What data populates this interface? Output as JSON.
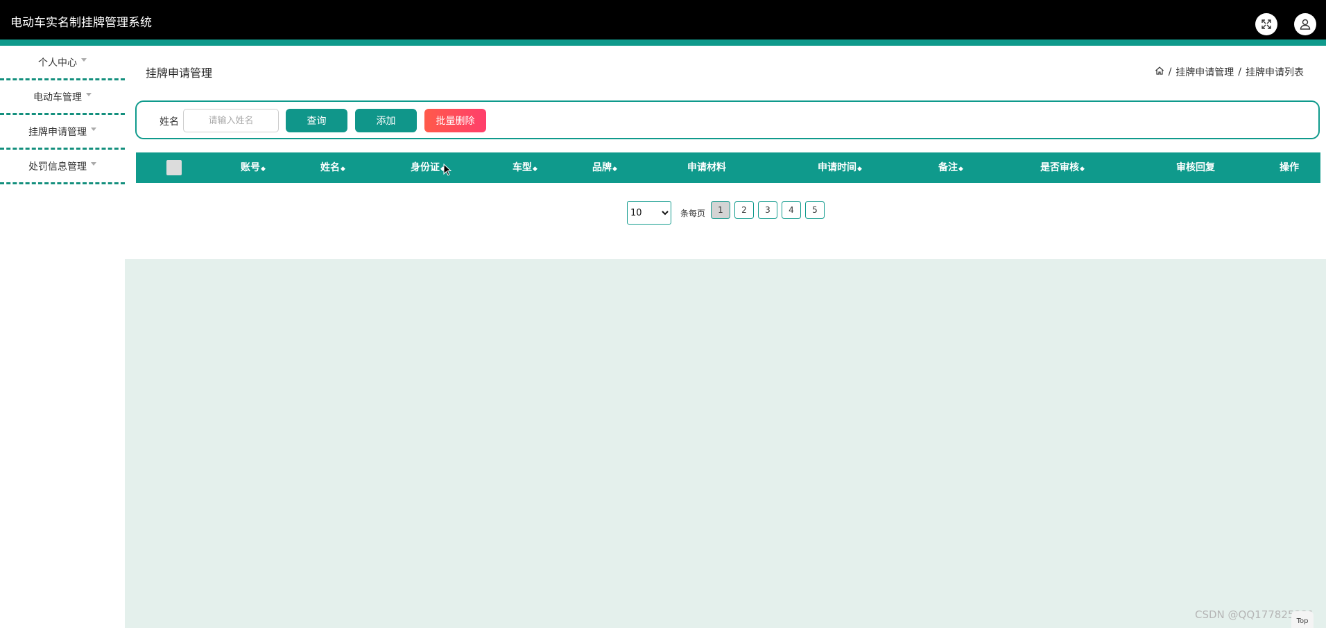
{
  "header": {
    "app_title": "电动车实名制挂牌管理系统",
    "icons": [
      "expand-icon",
      "user-icon"
    ]
  },
  "sidebar": {
    "items": [
      {
        "label": "个人中心"
      },
      {
        "label": "电动车管理"
      },
      {
        "label": "挂牌申请管理"
      },
      {
        "label": "处罚信息管理"
      }
    ]
  },
  "main": {
    "page_title": "挂牌申请管理",
    "breadcrumb": [
      "挂牌申请管理",
      "挂牌申请列表"
    ],
    "search": {
      "label": "姓名",
      "placeholder": "请输入姓名",
      "value": ""
    },
    "buttons": {
      "query": "查询",
      "add": "添加",
      "batch_delete": "批量删除"
    },
    "table": {
      "columns": [
        "账号",
        "姓名",
        "身份证",
        "车型",
        "品牌",
        "申请材料",
        "申请时间",
        "备注",
        "是否审核",
        "审核回复",
        "操作"
      ],
      "sortable": [
        true,
        true,
        true,
        true,
        true,
        false,
        true,
        true,
        true,
        false,
        false
      ],
      "rows": []
    },
    "pagination": {
      "page_size": "10",
      "per_page_label": "条每页",
      "pages": [
        "1",
        "2",
        "3",
        "4",
        "5"
      ],
      "current_page": "1"
    }
  },
  "footer": {
    "watermark": "CSDN @QQ1778253​31",
    "top_button": "Top"
  },
  "colors": {
    "accent": "#0f9a8c",
    "header_bg": "#000000",
    "danger": "#ff4a5a",
    "content_bg": "#e4f0ec"
  }
}
